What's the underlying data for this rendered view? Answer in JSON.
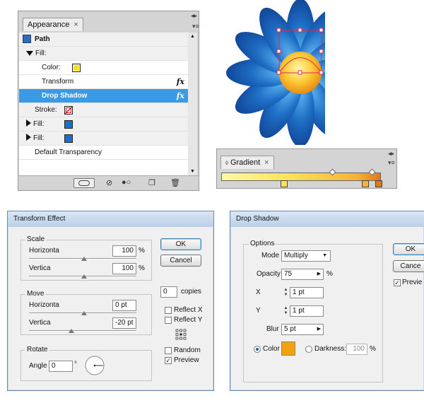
{
  "appearance": {
    "tab_title": "Appearance",
    "tab_close": "×",
    "header": "Path",
    "rows": [
      {
        "label": "Fill:"
      },
      {
        "label": "Color:",
        "swatch": "#f5e21d"
      },
      {
        "label": "Transform",
        "fx": "fx"
      },
      {
        "label": "Drop Shadow",
        "fx": "fx"
      },
      {
        "label": "Stroke:"
      },
      {
        "label": "Fill:",
        "swatch": "#1d6ec8"
      },
      {
        "label": "Fill:",
        "swatch": "#1d6ec8"
      },
      {
        "label": "Default Transparency"
      }
    ]
  },
  "gradient": {
    "tab_title": "Gradient",
    "tab_close": "×"
  },
  "transform": {
    "title": "Transform Effect",
    "scale_label": "Scale",
    "horizontal_label": "Horizonta",
    "horizontal_value": "100",
    "horizontal_unit": "%",
    "vertical_label": "Vertica",
    "vertical_value": "100",
    "vertical_unit": "%",
    "move_label": "Move",
    "move_h_label": "Horizonta",
    "move_h_value": "0 pt",
    "move_v_label": "Vertica",
    "move_v_value": "-20 pt",
    "rotate_label": "Rotate",
    "angle_label": "Angle",
    "angle_value": "0",
    "angle_unit": "°",
    "ok": "OK",
    "cancel": "Cancel",
    "copies_value": "0",
    "copies_label": "copies",
    "reflect_x": "Reflect X",
    "reflect_y": "Reflect Y",
    "random": "Random",
    "preview": "Preview",
    "preview_check": "✓"
  },
  "shadow": {
    "title": "Drop Shadow",
    "options_label": "Options",
    "mode_label": "Mode",
    "mode_value": "Multiply",
    "opacity_label": "Opacity",
    "opacity_value": "75",
    "opacity_unit": "%",
    "x_label": "X",
    "x_value": "1 pt",
    "y_label": "Y",
    "y_value": "1 pt",
    "blur_label": "Blur",
    "blur_value": "5 pt",
    "color_label": "Color",
    "color_swatch": "#f2a10f",
    "darkness_label": "Darkness:",
    "darkness_value": "100",
    "darkness_unit": "%",
    "ok": "OK",
    "cancel": "Cance",
    "preview": "Previe",
    "preview_check": "✓"
  },
  "colors": {
    "petal": "#1e6fc6",
    "center": "#fdc935",
    "selection": "#e0274c",
    "highlight": "#3a9ae6"
  }
}
